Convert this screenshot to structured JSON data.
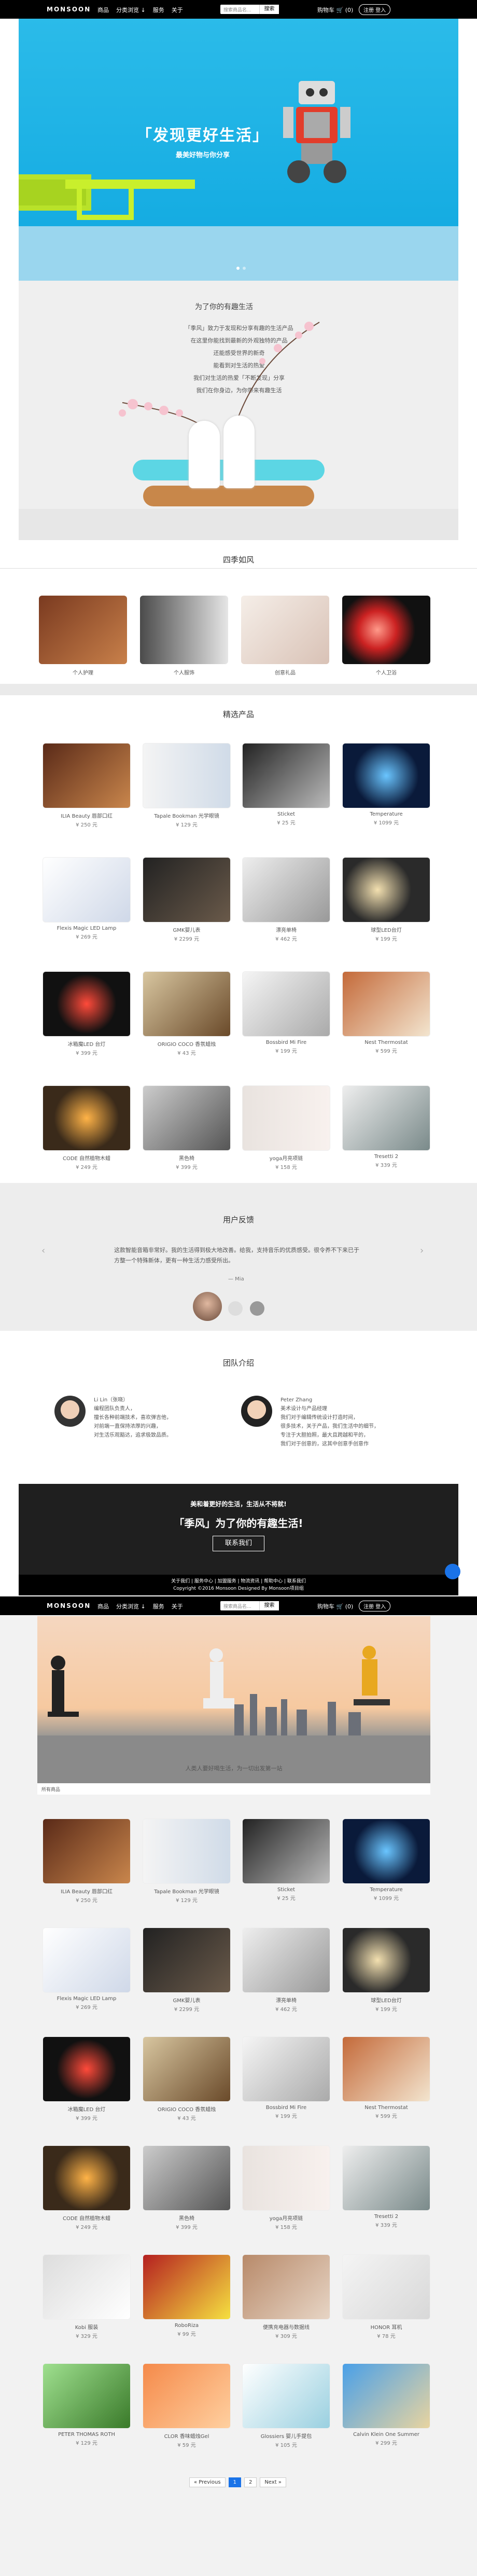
{
  "nav": {
    "logo": "MONSOON",
    "links": [
      "商品",
      "分类浏览 ↓",
      "服务",
      "关于"
    ],
    "search_placeholder": "搜索商品名...",
    "search_btn": "搜索",
    "cart": "购物车 🛒 (0)",
    "login": "注册  登入"
  },
  "hero": {
    "title": "「发现更好生活」",
    "subtitle": "最美好物与你分享"
  },
  "intro": {
    "title": "为了你的有趣生活",
    "lines": [
      "「季风」致力于发现和分享有趣的生活产品",
      "在这里你能找到最新的外观独特的产品",
      "还能感受世界的新奇",
      "能看到对生活的热爱",
      "我们对生活的热爱「不断发现」分享",
      "我们在你身边，为你带来有趣生活"
    ]
  },
  "seasons": {
    "title": "四季如风",
    "items": [
      "个人护理",
      "个人服饰",
      "创意礼品",
      "个人卫浴"
    ]
  },
  "featured": {
    "title": "精选产品",
    "items": [
      {
        "name": "ILIA Beauty 唇部口红",
        "price": "¥ 250 元"
      },
      {
        "name": "Tapale Bookman 光学眼镜",
        "price": "¥ 129 元"
      },
      {
        "name": "Sticket",
        "price": "¥ 25 元"
      },
      {
        "name": "Temperature",
        "price": "¥ 1099 元"
      },
      {
        "name": "Flexis Magic LED Lamp",
        "price": "¥ 269 元"
      },
      {
        "name": "GMK婴儿表",
        "price": "¥ 2299 元"
      },
      {
        "name": "漂亮单椅",
        "price": "¥ 462 元"
      },
      {
        "name": "球型LED台灯",
        "price": "¥ 199 元"
      },
      {
        "name": "冰箱魔LED 台灯",
        "price": "¥ 399 元"
      },
      {
        "name": "ORIGIO COCO 香氛蜡烛",
        "price": "¥ 43 元"
      },
      {
        "name": "Bossbird Mi Fire",
        "price": "¥ 199 元"
      },
      {
        "name": "Nest Thermostat",
        "price": "¥ 599 元"
      },
      {
        "name": "CODE 自然植物木蜡",
        "price": "¥ 249 元"
      },
      {
        "name": "黑色椅",
        "price": "¥ 399 元"
      },
      {
        "name": "yoga月亮项链",
        "price": "¥ 158 元"
      },
      {
        "name": "Tresetti 2",
        "price": "¥ 339 元"
      }
    ]
  },
  "reviews": {
    "title": "用户反馈",
    "quote": "这款智能音箱非常好。我的生活得到极大地改善。给我，支持音乐的优质感受。很令养不下来已于方整一个特殊新体，更有一种生活力感受所出。",
    "name": "—  Mia"
  },
  "team": {
    "title": "团队介绍",
    "members": [
      {
        "name": "Li Lin（张晓）",
        "lines": [
          "编程团队负责人，",
          "擅长各种前端技术，喜欢弹吉他，",
          "对前端一直保持浓厚的兴趣，",
          "对生活乐观豁达，追求极致品质。"
        ]
      },
      {
        "name": "Peter Zhang",
        "lines": [
          "美术设计与产品经理",
          "我们对于编辑传统设计打造时间，",
          "很多技术，关于产品，我们生活中的细节，",
          "专注于大胆拍照，最大且跨越和平的，",
          "我们对于创意的，这其中创意手创意作"
        ]
      }
    ]
  },
  "cta": {
    "line1": "美和着更好的生活，生活从不将就!",
    "line2": "「季风」为了你的有趣生活!",
    "button": "联系我们"
  },
  "footer": {
    "links": "关于我们 | 服务中心 | 加盟服务 | 物流资讯 | 帮助中心 | 联系我们",
    "copy": "Copyright ©2016 Monsoon Designed By Monsoon项目组"
  },
  "page2": {
    "banner_caption": "人类人要好喝生活，为一切出发第一站",
    "crumb": "所有商品",
    "pager": [
      "« Previous",
      "1",
      "2",
      "Next »"
    ]
  },
  "products": {
    "items": [
      {
        "name": "ILIA Beauty 唇部口红",
        "price": "¥ 250 元"
      },
      {
        "name": "Tapale Bookman 光学眼镜",
        "price": "¥ 129 元"
      },
      {
        "name": "Sticket",
        "price": "¥ 25 元"
      },
      {
        "name": "Temperature",
        "price": "¥ 1099 元"
      },
      {
        "name": "Flexis Magic LED Lamp",
        "price": "¥ 269 元"
      },
      {
        "name": "GMK婴儿表",
        "price": "¥ 2299 元"
      },
      {
        "name": "漂亮单椅",
        "price": "¥ 462 元"
      },
      {
        "name": "球型LED台灯",
        "price": "¥ 199 元"
      },
      {
        "name": "冰箱魔LED 台灯",
        "price": "¥ 399 元"
      },
      {
        "name": "ORIGIO COCO 香氛蜡烛",
        "price": "¥ 43 元"
      },
      {
        "name": "Bossbird Mi Fire",
        "price": "¥ 199 元"
      },
      {
        "name": "Nest Thermostat",
        "price": "¥ 599 元"
      },
      {
        "name": "CODE 自然植物木蜡",
        "price": "¥ 249 元"
      },
      {
        "name": "黑色椅",
        "price": "¥ 399 元"
      },
      {
        "name": "yoga月亮项链",
        "price": "¥ 158 元"
      },
      {
        "name": "Tresetti 2",
        "price": "¥ 339 元"
      },
      {
        "name": "Kobi 服装",
        "price": "¥ 329 元"
      },
      {
        "name": "RoboRiza",
        "price": "¥ 99 元"
      },
      {
        "name": "便携充电器与数据线",
        "price": "¥ 309 元"
      },
      {
        "name": "HONOR 耳机",
        "price": "¥ 78 元"
      },
      {
        "name": "PETER THOMAS ROTH",
        "price": "¥ 129 元"
      },
      {
        "name": "CLOR 香味蜡烛Gel",
        "price": "¥ 59 元"
      },
      {
        "name": "Glossiers 婴儿手提包",
        "price": "¥ 105 元"
      },
      {
        "name": "Calvin Klein One Summer",
        "price": "¥ 299 元"
      }
    ]
  }
}
